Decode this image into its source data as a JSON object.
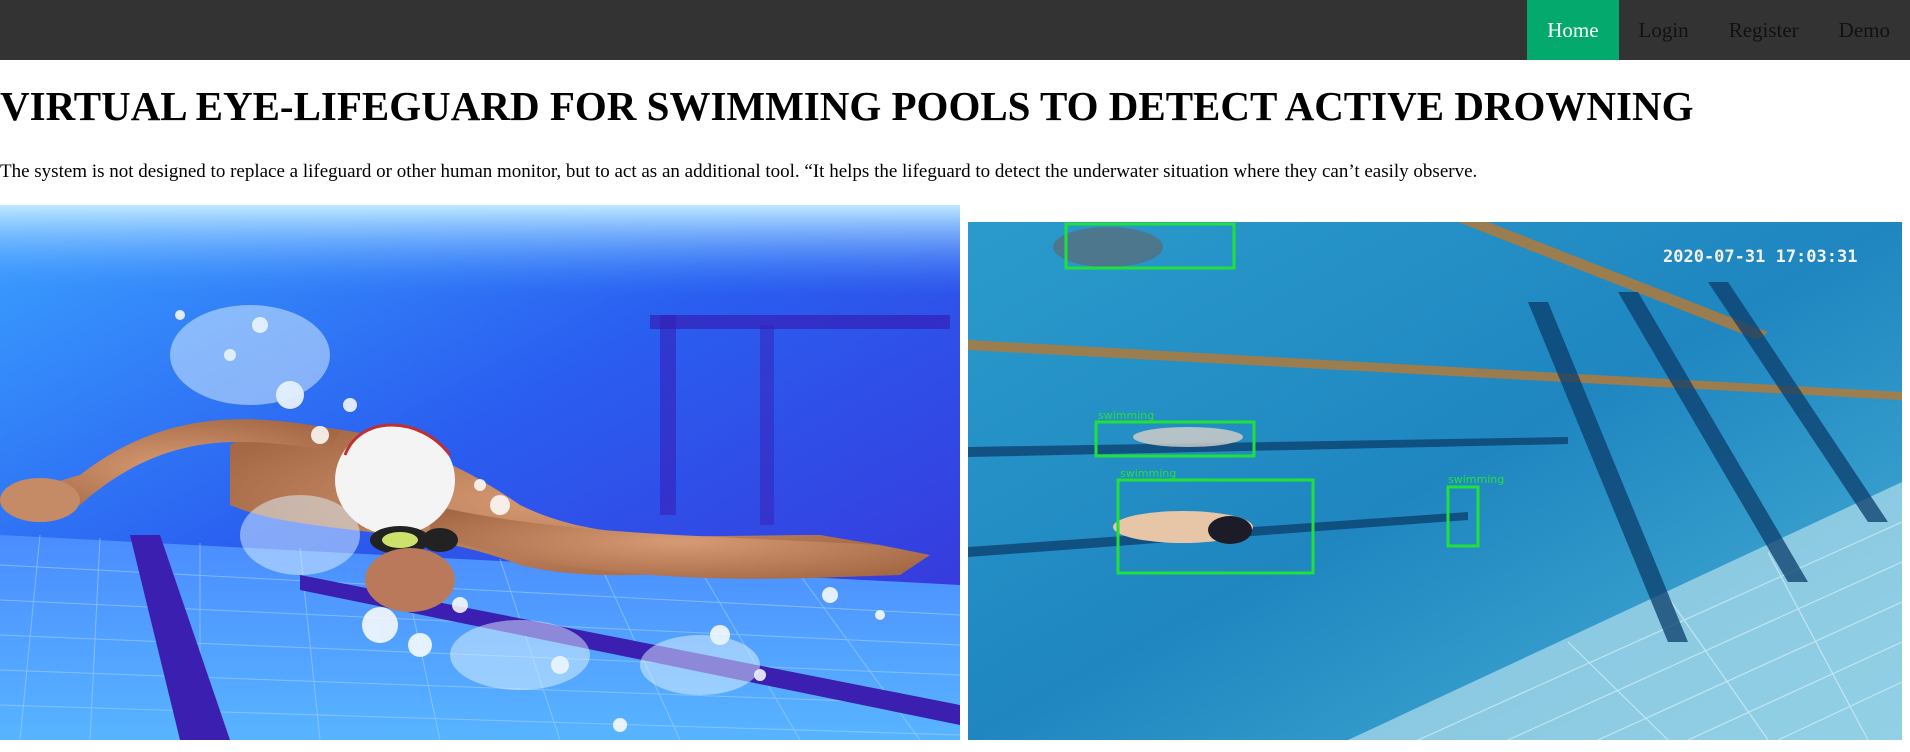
{
  "nav": {
    "items": [
      {
        "label": "Home",
        "active": true
      },
      {
        "label": "Login",
        "active": false
      },
      {
        "label": "Register",
        "active": false
      },
      {
        "label": "Demo",
        "active": false
      }
    ],
    "active_color": "#04AA6D",
    "bar_color": "#333333"
  },
  "hero": {
    "title": "VIRTUAL EYE-LIFEGUARD FOR SWIMMING POOLS TO DETECT ACTIVE DROWNING",
    "description": "The system is not designed to replace a lifeguard or other human monitor, but to act as an additional tool. “It helps the lifeguard to detect the underwater situation where they can’t easily observe."
  },
  "detection_image": {
    "timestamp": "2020-07-31 17:03:31",
    "labels": [
      "swimming",
      "swimming",
      "swimming"
    ],
    "box_color": "#22e03a"
  }
}
